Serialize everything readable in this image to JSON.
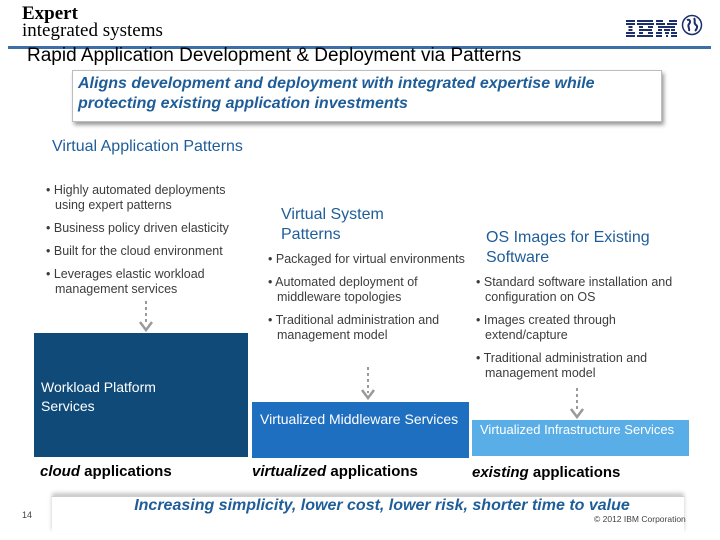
{
  "header": {
    "logo_line1": "Expert",
    "logo_line2": "integrated systems",
    "ibm_logo": "IBM",
    "globe_icon": "globe-icon",
    "title": "Rapid Application Development & Deployment via Patterns"
  },
  "banner": {
    "text": "Aligns development and deployment with integrated expertise while protecting existing application investments"
  },
  "columns": [
    {
      "title": "Virtual Application Patterns",
      "bullets": [
        "Highly automated deployments using expert patterns",
        "Business policy driven elasticity",
        "Built for the cloud environment",
        "Leverages elastic workload management services"
      ],
      "box_label": "Workload Platform Services",
      "box_color": "#0f4a78",
      "footer_emph": "cloud",
      "footer_rest": " applications"
    },
    {
      "title": "Virtual System Patterns",
      "bullets": [
        "Packaged for virtual environments",
        "Automated deployment of middleware topologies",
        "Traditional administration and management model"
      ],
      "box_label": "Virtualized Middleware Services",
      "box_color": "#1f6fc0",
      "footer_emph": "virtualized",
      "footer_rest": " applications"
    },
    {
      "title": "OS Images for Existing Software",
      "bullets": [
        "Standard software installation and configuration on OS",
        "Images created through extend/capture",
        "Traditional administration and management model"
      ],
      "box_label": "Virtualized Infrastructure Services",
      "box_color": "#5aaee8",
      "footer_emph": "existing",
      "footer_rest": " applications"
    }
  ],
  "bottom": {
    "tagline": "Increasing simplicity, lower cost, lower risk, shorter time to value",
    "page_number": "14",
    "copyright": "© 2012 IBM Corporation"
  }
}
